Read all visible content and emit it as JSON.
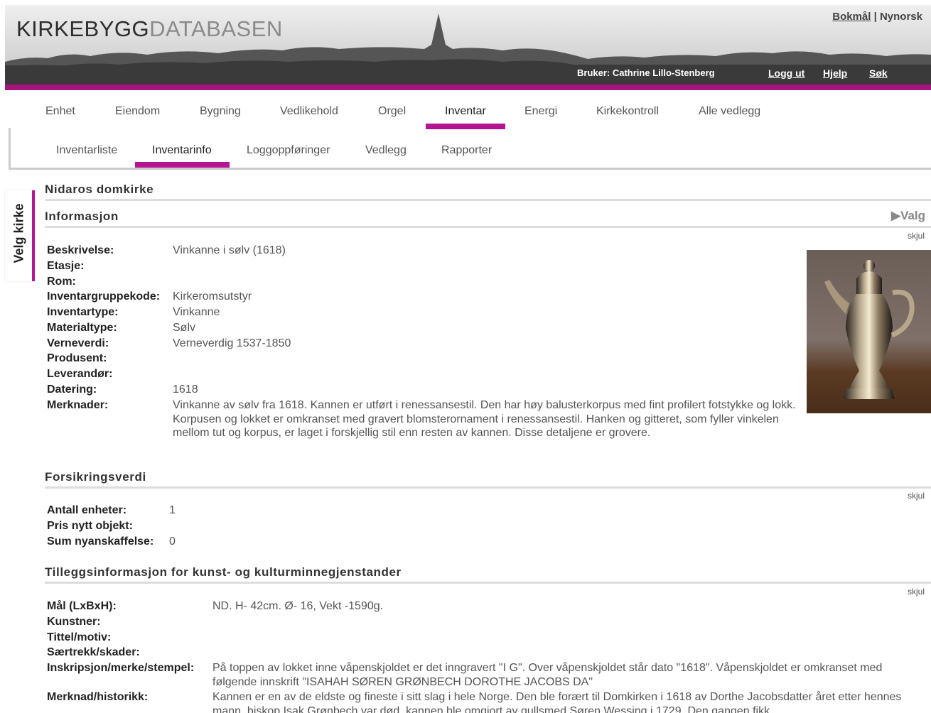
{
  "header": {
    "logo_part1": "KIRKEBYGG",
    "logo_part2": "DATABASEN",
    "lang_bokmal": "Bokmål",
    "lang_sep": " | ",
    "lang_nynorsk": "Nynorsk",
    "user": "Bruker: Cathrine Lillo-Stenberg",
    "logout": "Logg ut",
    "help": "Hjelp",
    "search": "Søk"
  },
  "main_nav": [
    "Enhet",
    "Eiendom",
    "Bygning",
    "Vedlikehold",
    "Orgel",
    "Inventar",
    "Energi",
    "Kirkekontroll",
    "Alle vedlegg"
  ],
  "main_nav_active": "Inventar",
  "sub_nav": [
    "Inventarliste",
    "Inventarinfo",
    "Loggoppføringer",
    "Vedlegg",
    "Rapporter"
  ],
  "sub_nav_active": "Inventarinfo",
  "side_tab": "Velg kirke",
  "church_name": "Nidaros domkirke",
  "info": {
    "heading": "Informasjon",
    "valg": "Valg",
    "hide": "skjul",
    "fields": [
      {
        "label": "Beskrivelse:",
        "value": "Vinkanne i sølv (1618)"
      },
      {
        "label": "Etasje:",
        "value": ""
      },
      {
        "label": "Rom:",
        "value": ""
      },
      {
        "label": "Inventargruppekode:",
        "value": "Kirkeromsutstyr"
      },
      {
        "label": "Inventartype:",
        "value": "Vinkanne"
      },
      {
        "label": "Materialtype:",
        "value": "Sølv"
      },
      {
        "label": "Verneverdi:",
        "value": "Verneverdig 1537-1850"
      },
      {
        "label": "Produsent:",
        "value": ""
      },
      {
        "label": "Leverandør:",
        "value": ""
      },
      {
        "label": "Datering:",
        "value": "1618"
      },
      {
        "label": "Merknader:",
        "value": ""
      }
    ],
    "merknader": "Vinkanne av sølv fra 1618. Kannen er utført i renessansestil. Den har høy balusterkorpus med fint profilert fotstykke og lokk. Korpusen og lokket er omkranset med gravert blomsterornament i renessansestil. Hanken og gitteret, som fyller vinkelen mellom tut og korpus, er laget i forskjellig stil enn resten av kannen. Disse detaljene er grovere."
  },
  "insurance": {
    "heading": "Forsikringsverdi",
    "hide": "skjul",
    "fields": [
      {
        "label": "Antall enheter:",
        "value": "1"
      },
      {
        "label": "Pris nytt objekt:",
        "value": ""
      },
      {
        "label": "Sum nyanskaffelse:",
        "value": "0"
      }
    ]
  },
  "extra": {
    "heading": "Tilleggsinformasjon for kunst- og kulturminnegjenstander",
    "hide": "skjul",
    "fields": [
      {
        "label": "Mål (LxBxH):",
        "value": "ND. H- 42cm. Ø- 16, Vekt -1590g."
      },
      {
        "label": "Kunstner:",
        "value": ""
      },
      {
        "label": "Tittel/motiv:",
        "value": ""
      },
      {
        "label": "Særtrekk/skader:",
        "value": ""
      },
      {
        "label": "Inskripsjon/merke/stempel:",
        "value": ""
      },
      {
        "label": "Merknad/historikk:",
        "value": ""
      }
    ],
    "inskripsjon": "På toppen av lokket inne våpenskjoldet er det inngravert \"I G\". Over våpenskjoldet står dato \"1618\". Våpenskjoldet er omkranset med følgende innskrift \"ISAHAH SØREN GRØNBECH DOROTHE JACOBS DA\"",
    "historikk": "Kannen er en av de eldste og fineste i sitt slag i hele Norge. Den ble forært til Domkirken i 1618 av Dorthe Jacobsdatter året etter hennes mann, biskop Isak Grønbech var død, kannen ble omgjort av gullsmed Søren Wessing i 1729. Den gangen fikk"
  },
  "colors": {
    "accent": "#b51593",
    "header_dark": "#3a3a3a"
  },
  "icons": {
    "valg": "play-triangle-icon"
  }
}
